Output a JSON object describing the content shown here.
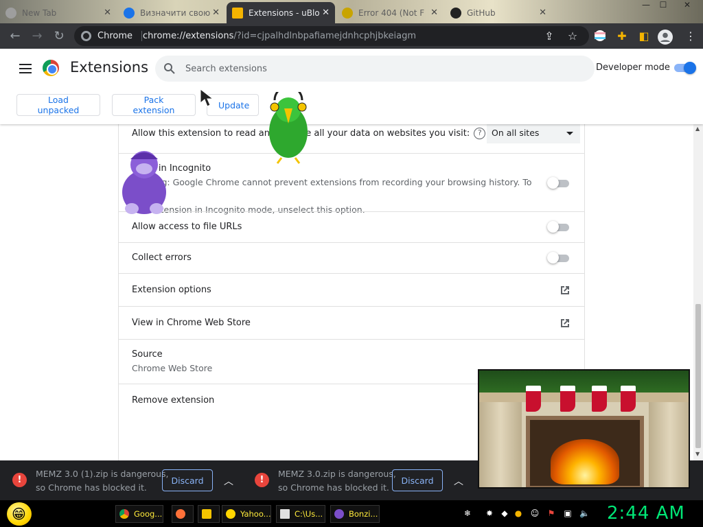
{
  "browser": {
    "tabs": [
      {
        "label": "New Tab",
        "icon": "new-tab-icon"
      },
      {
        "label": "Визначити свою",
        "icon": "gear-icon"
      },
      {
        "label": "Extensions - uBlo",
        "icon": "puzzle-icon",
        "active": true
      },
      {
        "label": "Error 404 (Not F",
        "icon": "warning-icon"
      },
      {
        "label": "GitHub",
        "icon": "github-icon"
      }
    ],
    "window_controls": {
      "minimize": "—",
      "maximize": "☐",
      "close": "✕"
    },
    "omnibox": {
      "site": "Chrome",
      "url_host": "chrome://extensions",
      "url_rest": "/?id=cjpalhdlnbpafiamejdnhcphjbkeiagm"
    }
  },
  "header": {
    "title": "Extensions",
    "search_placeholder": "Search extensions",
    "developer_mode_label": "Developer mode",
    "buttons": {
      "load_unpacked": "Load unpacked",
      "pack_extension": "Pack extension",
      "update": "Update"
    }
  },
  "details": {
    "site_access_label": "Allow this extension to read and change all your data on websites you visit:",
    "site_access_value": "On all sites",
    "incognito_title": "Allow in Incognito",
    "incognito_warning_1": "Warning: Google Chrome cannot prevent extensions from recording your browsing history. To disable",
    "incognito_warning_2": "this extension in Incognito mode, unselect this option.",
    "file_urls_label": "Allow access to file URLs",
    "collect_errors_label": "Collect errors",
    "options_label": "Extension options",
    "webstore_label": "View in Chrome Web Store",
    "source_label": "Source",
    "source_value": "Chrome Web Store",
    "remove_label": "Remove extension"
  },
  "downloads": [
    {
      "line1": "MEMZ 3.0 (1).zip is dangerous,",
      "line2": "so Chrome has blocked it.",
      "button": "Discard"
    },
    {
      "line1": "MEMZ 3.0.zip is dangerous,",
      "line2": "so Chrome has blocked it.",
      "button": "Discard"
    }
  ],
  "taskbar": {
    "items": [
      {
        "label": "Goog...",
        "icon": "chrome-icon"
      },
      {
        "label": "",
        "icon": "firefox-icon"
      },
      {
        "label": "",
        "icon": "folder-icon"
      },
      {
        "label": "Yahoo...",
        "icon": "smiley-icon"
      },
      {
        "label": "C:\\Us...",
        "icon": "archive-icon"
      },
      {
        "label": "Bonzi...",
        "icon": "bonzi-icon"
      }
    ],
    "clock": "2:44 AM"
  },
  "colors": {
    "accent": "#1a73e8",
    "dark_toolbar": "#35363a",
    "clock_green": "#00e676",
    "danger": "#e8453c"
  }
}
